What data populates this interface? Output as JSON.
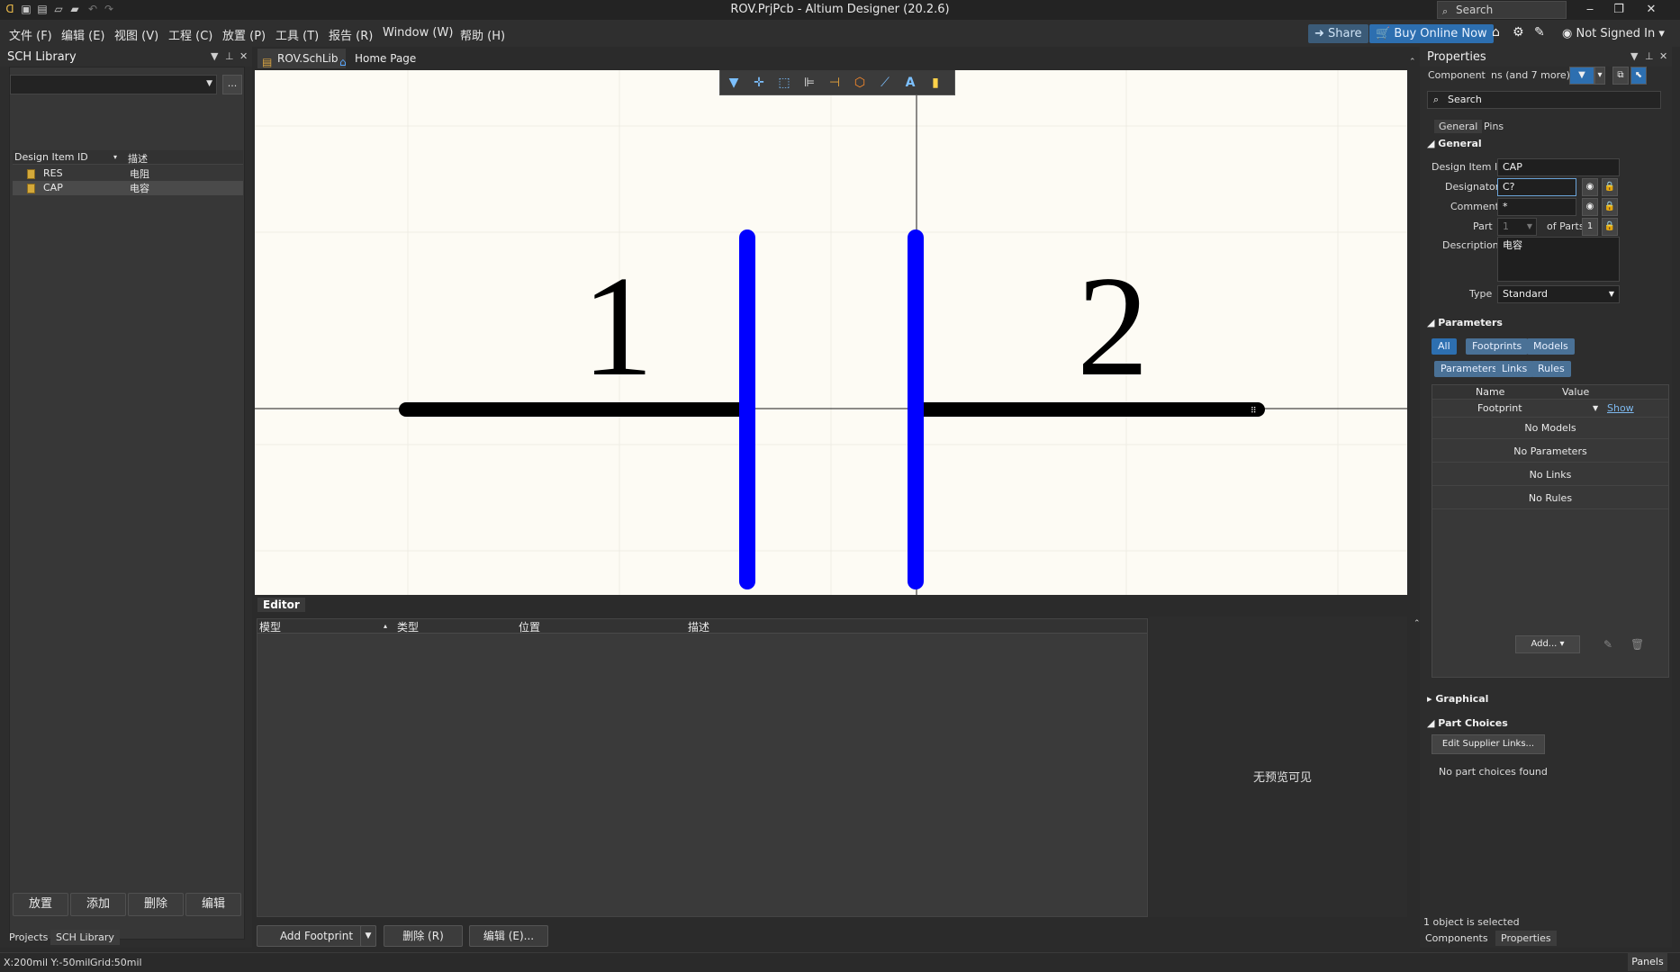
{
  "window": {
    "title": "ROV.PrjPcb - Altium Designer (20.2.6)",
    "search_placeholder": "Search",
    "minimize": "‒",
    "maximize": "❐",
    "close": "✕"
  },
  "menu": [
    "文件 (F)",
    "编辑 (E)",
    "视图 (V)",
    "工程 (C)",
    "放置 (P)",
    "工具 (T)",
    "报告 (R)",
    "Window (W)",
    "帮助 (H)"
  ],
  "header": {
    "share_label": "Share",
    "buy_label": "Buy Online Now",
    "user_label": "Not Signed In"
  },
  "left_panel": {
    "title": "SCH Library",
    "filter_dots": "...",
    "col_id": "Design Item ID",
    "col_desc": "描述",
    "rows": [
      {
        "id": "RES",
        "desc": "电阻"
      },
      {
        "id": "CAP",
        "desc": "电容"
      }
    ],
    "buttons": [
      "放置",
      "添加",
      "删除",
      "编辑"
    ],
    "tabs": [
      "Projects",
      "SCH Library"
    ]
  },
  "doc_tabs": [
    {
      "label": "ROV.SchLib"
    },
    {
      "label": "Home Page"
    }
  ],
  "canvas": {
    "pin1_label": "1",
    "pin2_label": "2",
    "pin_color": "#0000ff",
    "body_color": "#000000",
    "background": "#fdfbf4"
  },
  "editor": {
    "tab_label": "Editor",
    "col_model": "模型",
    "col_type": "类型",
    "col_position": "位置",
    "col_desc": "描述",
    "no_preview": "无预览可见",
    "add_footprint": "Add Footprint",
    "delete_btn": "删除 (R)",
    "edit_btn": "编辑 (E)..."
  },
  "properties": {
    "title": "Properties",
    "component_label": "Component",
    "component_filter": "ns (and 7 more)",
    "search_placeholder": "Search",
    "tab_general": "General",
    "tab_pins": "Pins",
    "section_general": "General",
    "design_item_id_label": "Design Item ID",
    "design_item_id": "CAP",
    "designator_label": "Designator",
    "designator": "C?",
    "comment_label": "Comment",
    "comment": "*",
    "part_label": "Part",
    "part_value": "1",
    "of_parts_label": "of Parts",
    "of_parts_value": "1",
    "description_label": "Description",
    "description": "电容",
    "type_label": "Type",
    "type_value": "Standard",
    "section_parameters": "Parameters",
    "filter_all": "All",
    "filter_footprints": "Footprints",
    "filter_models": "Models",
    "filter_parameters": "Parameters",
    "filter_links": "Links",
    "filter_rules": "Rules",
    "param_col_name": "Name",
    "param_col_value": "Value",
    "footprint_label": "Footprint",
    "footprint_show": "Show",
    "no_models": "No Models",
    "no_parameters": "No Parameters",
    "no_links": "No Links",
    "no_rules": "No Rules",
    "add_btn": "Add...",
    "section_graphical": "Graphical",
    "section_part_choices": "Part Choices",
    "edit_supplier_links": "Edit Supplier Links...",
    "no_part_choices": "No part choices found",
    "selection_status": "1 object is selected",
    "tabs": [
      "Components",
      "Properties"
    ]
  },
  "statusbar": {
    "coords": "X:200mil Y:-50mil",
    "grid": "Grid:50mil",
    "panels": "Panels"
  }
}
